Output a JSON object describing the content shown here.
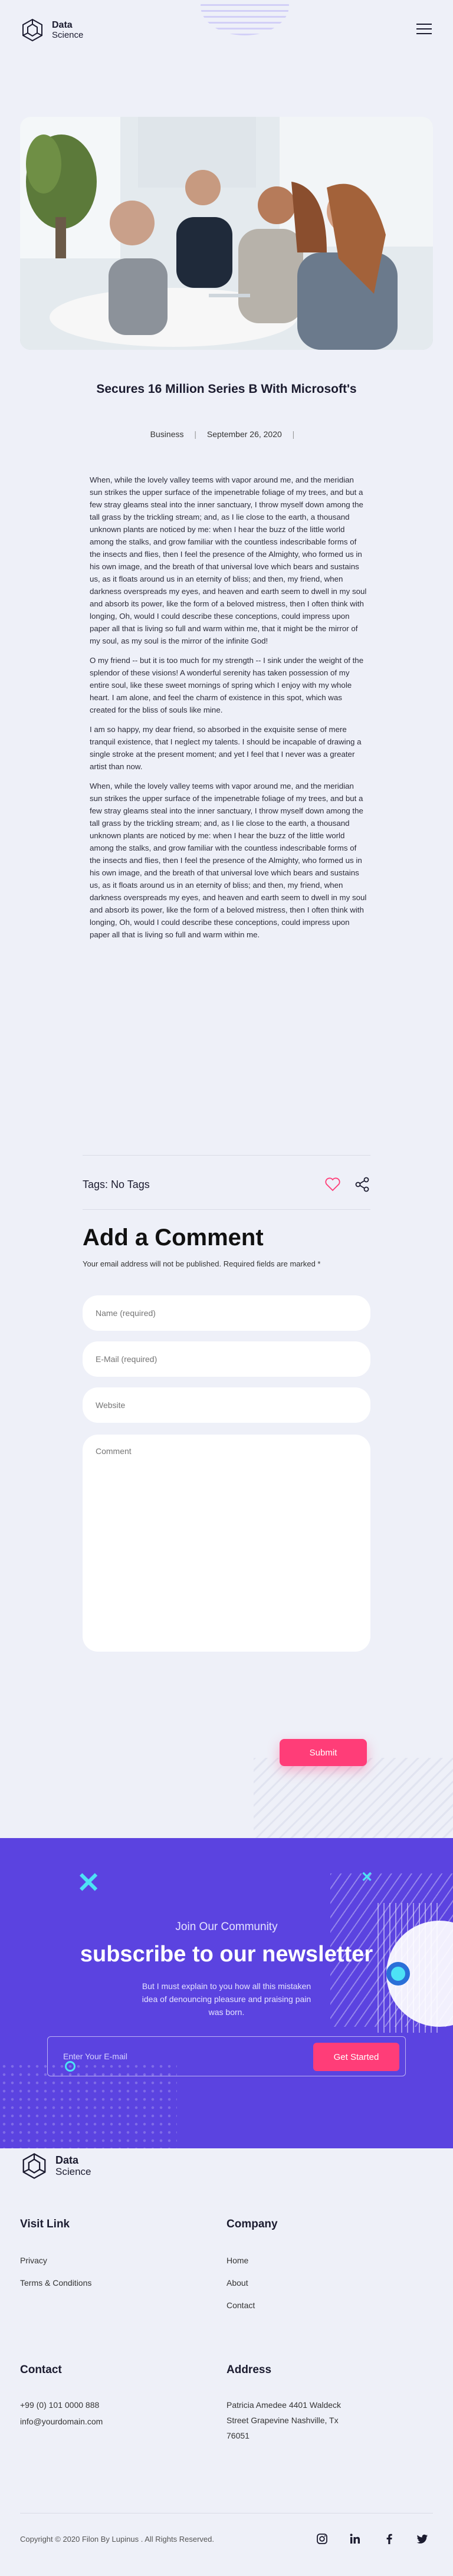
{
  "brand": {
    "line1": "Data",
    "line2": "Science"
  },
  "post": {
    "title": "Secures 16 Million Series B With Microsoft's",
    "category": "Business",
    "date": "September 26, 2020",
    "paragraphs": [
      "When, while the lovely valley teems with vapor around me, and the meridian sun strikes the upper surface of the impenetrable foliage of my trees, and but a few stray gleams steal into the inner sanctuary, I throw myself down among the tall grass by the trickling stream; and, as I lie close to the earth, a thousand unknown plants are noticed by me: when I hear the buzz of the little world among the stalks, and grow familiar with the countless indescribable forms of the insects and flies, then I feel the presence of the Almighty, who formed us in his own image, and the breath of that universal love which bears and sustains us, as it floats around us in an eternity of bliss; and then, my friend, when darkness overspreads my eyes, and heaven and earth seem to dwell in my soul and absorb its power, like the form of a beloved mistress, then I often think with longing, Oh, would I could describe these conceptions, could impress upon paper all that is living so full and warm within me, that it might be the mirror of my soul, as my soul is the mirror of the infinite God!",
      "O my friend -- but it is too much for my strength -- I sink under the weight of the splendor of these visions! A wonderful serenity has taken possession of my entire soul, like these sweet mornings of spring which I enjoy with my whole heart. I am alone, and feel the charm of existence in this spot, which was created for the bliss of souls like mine.",
      "I am so happy, my dear friend, so absorbed in the exquisite sense of mere tranquil existence, that I neglect my talents. I should be incapable of drawing a single stroke at the present moment; and yet I feel that I never was a greater artist than now.",
      "When, while the lovely valley teems with vapor around me, and the meridian sun strikes the upper surface of the impenetrable foliage of my trees, and but a few stray gleams steal into the inner sanctuary, I throw myself down among the tall grass by the trickling stream; and, as I lie close to the earth, a thousand unknown plants are noticed by me: when I hear the buzz of the little world among the stalks, and grow familiar with the countless indescribable forms of the insects and flies, then I feel the presence of the Almighty, who formed us in his own image, and the breath of that universal love which bears and sustains us, as it floats around us in an eternity of bliss; and then, my friend, when darkness overspreads my eyes, and heaven and earth seem to dwell in my soul and absorb its power, like the form of a beloved mistress, then I often think with longing, Oh, would I could describe these conceptions, could impress upon paper all that is living so full and warm within me."
    ],
    "tags_label": "Tags: No Tags"
  },
  "comment_form": {
    "title": "Add a Comment",
    "note": "Your email address will not be published. Required fields are marked *",
    "name_placeholder": "Name (required)",
    "email_placeholder": "E-Mail (required)",
    "website_placeholder": "Website",
    "comment_placeholder": "Comment",
    "submit_label": "Submit"
  },
  "newsletter": {
    "subtitle": "Join Our Community",
    "title": "subscribe to our newsletter",
    "text": "But I must explain to you how all this mistaken idea of denouncing pleasure and praising pain was born.",
    "email_placeholder": "Enter Your E-mail",
    "button_label": "Get Started"
  },
  "footer": {
    "visit_link": {
      "heading": "Visit Link",
      "links": [
        "Privacy",
        "Terms & Conditions"
      ]
    },
    "company": {
      "heading": "Company",
      "links": [
        "Home",
        "About",
        "Contact"
      ]
    },
    "contact": {
      "heading": "Contact",
      "phone": "+99 (0) 101 0000 888",
      "email": "info@yourdomain.com"
    },
    "address": {
      "heading": "Address",
      "line1": "Patricia Amedee 4401 Waldeck",
      "line2": "Street Grapevine Nashville, Tx",
      "line3": "76051"
    },
    "copyright": "Copyright © 2020 Filon By Lupinus . All Rights Reserved."
  },
  "colors": {
    "accent": "#ff3d78",
    "newsletter_bg": "#5b43e0",
    "cyan": "#4de2f5",
    "page_bg": "#eef0f8"
  },
  "icons": [
    "menu-icon",
    "heart-icon",
    "share-icon",
    "instagram-icon",
    "linkedin-icon",
    "facebook-icon",
    "twitter-icon"
  ]
}
